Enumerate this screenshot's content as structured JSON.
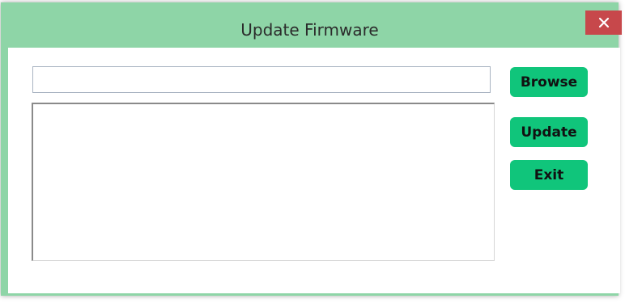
{
  "window": {
    "title": "Update Firmware",
    "close_icon": "close-icon"
  },
  "form": {
    "file_path_value": "",
    "log_text": ""
  },
  "buttons": {
    "browse_label": "Browse",
    "update_label": "Update",
    "exit_label": "Exit"
  },
  "colors": {
    "frame": "#8ed5a7",
    "close_button": "#c7484b",
    "button_fill": "#10c57b"
  }
}
